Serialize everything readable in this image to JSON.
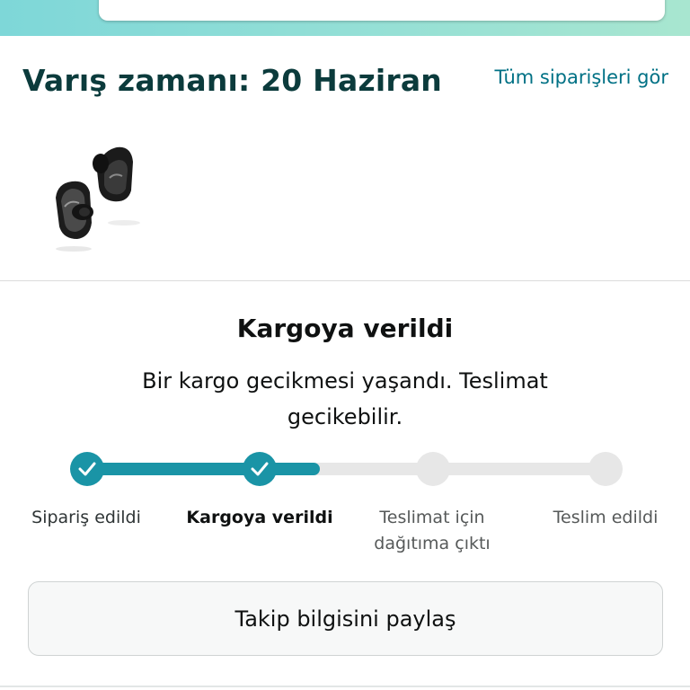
{
  "header": {
    "arrival_label": "Varış zamanı: 20 Haziran",
    "all_orders_link": "Tüm siparişleri gör"
  },
  "product": {
    "image_icon": "earbuds-product-image"
  },
  "status": {
    "title": "Kargoya verildi",
    "message": "Bir kargo gecikmesi yaşandı. Teslimat gecikebilir.",
    "progress_fraction": 0.45
  },
  "steps": [
    {
      "label": "Sipariş edildi",
      "state": "done"
    },
    {
      "label": "Kargoya verildi",
      "state": "current"
    },
    {
      "label": "Teslimat için dağıtıma çıktı",
      "state": "future"
    },
    {
      "label": "Teslim edildi",
      "state": "future"
    }
  ],
  "actions": {
    "share_label": "Takip bilgisini paylaş"
  },
  "colors": {
    "accent": "#1a94a6",
    "link": "#007185",
    "title": "#0b3b3c",
    "track": "#e7e7e7"
  }
}
